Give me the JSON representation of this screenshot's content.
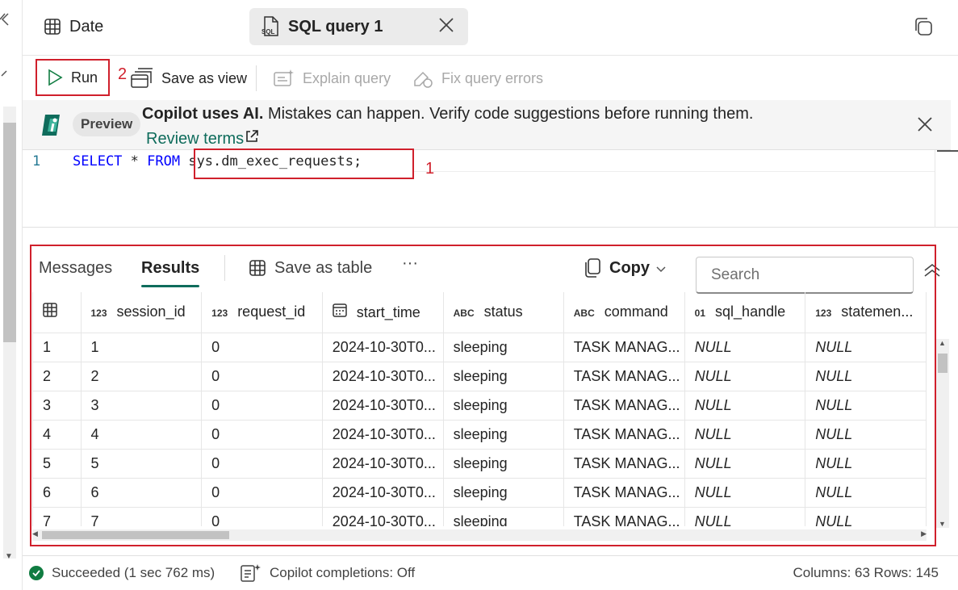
{
  "tabs": [
    {
      "label": "Date",
      "icon": "table-icon"
    },
    {
      "label": "SQL query 1",
      "icon": "sql-file-icon",
      "active": true
    }
  ],
  "toolbar": {
    "run_label": "Run",
    "save_view_label": "Save as view",
    "explain_label": "Explain query",
    "fix_label": "Fix query errors"
  },
  "annotations": {
    "mark_run": "2",
    "mark_query": "1",
    "highlight_color": "#d0202c"
  },
  "banner": {
    "badge": "Preview",
    "message_bold": "Copilot uses AI.",
    "message": " Mistakes can happen. Verify code suggestions before running them.",
    "link": "Review terms"
  },
  "editor": {
    "line_number": "1",
    "keyword1": "SELECT",
    "star": " * ",
    "keyword2": "FROM",
    "rest": " sys.dm_exec_requests;"
  },
  "results": {
    "tabs": {
      "messages": "Messages",
      "results": "Results",
      "save_table": "Save as table",
      "more": "···",
      "copy": "Copy"
    },
    "search_placeholder": "Search",
    "columns": [
      {
        "type": "123",
        "name": "session_id"
      },
      {
        "type": "123",
        "name": "request_id"
      },
      {
        "type": "cal",
        "name": "start_time"
      },
      {
        "type": "ABC",
        "name": "status"
      },
      {
        "type": "ABC",
        "name": "command"
      },
      {
        "type": "01",
        "name": "sql_handle"
      },
      {
        "type": "123",
        "name": "statemen..."
      }
    ],
    "rows": [
      [
        "1",
        "1",
        "0",
        "2024-10-30T0...",
        "sleeping",
        "TASK MANAG...",
        "NULL",
        "NULL"
      ],
      [
        "2",
        "2",
        "0",
        "2024-10-30T0...",
        "sleeping",
        "TASK MANAG...",
        "NULL",
        "NULL"
      ],
      [
        "3",
        "3",
        "0",
        "2024-10-30T0...",
        "sleeping",
        "TASK MANAG...",
        "NULL",
        "NULL"
      ],
      [
        "4",
        "4",
        "0",
        "2024-10-30T0...",
        "sleeping",
        "TASK MANAG...",
        "NULL",
        "NULL"
      ],
      [
        "5",
        "5",
        "0",
        "2024-10-30T0...",
        "sleeping",
        "TASK MANAG...",
        "NULL",
        "NULL"
      ],
      [
        "6",
        "6",
        "0",
        "2024-10-30T0...",
        "sleeping",
        "TASK MANAG...",
        "NULL",
        "NULL"
      ],
      [
        "7",
        "7",
        "0",
        "2024-10-30T0...",
        "sleeping",
        "TASK MANAG...",
        "NULL",
        "NULL"
      ]
    ]
  },
  "status": {
    "succeeded": "Succeeded (1 sec 762 ms)",
    "copilot": "Copilot completions: Off",
    "counts": "Columns: 63 Rows: 145"
  },
  "colors": {
    "accent": "#0f6c5c",
    "success": "#107c41",
    "keyword": "#0000ff"
  }
}
